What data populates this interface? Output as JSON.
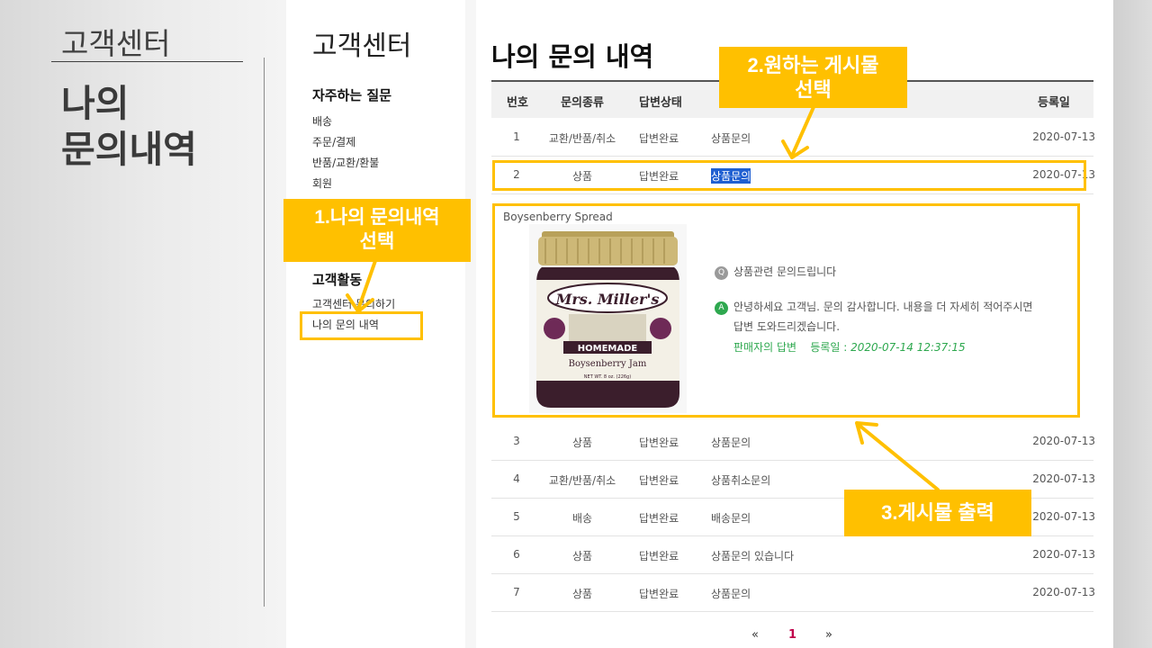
{
  "slide": {
    "subtitle": "고객센터",
    "title_line1": "나의",
    "title_line2": "문의내역"
  },
  "sidebar": {
    "title": "고객센터",
    "faq_heading": "자주하는 질문",
    "faq_items": [
      "배송",
      "주문/결제",
      "반품/교환/환불",
      "회원"
    ],
    "activity_heading": "고객활동",
    "activity_items": [
      "고객센터 문의하기",
      "나의 문의 내역"
    ]
  },
  "main": {
    "title": "나의 문의 내역",
    "columns": [
      "번호",
      "문의종류",
      "답변상태",
      "등록일"
    ],
    "rows": [
      {
        "num": "1",
        "type": "교환/반품/취소",
        "status": "답변완료",
        "title": "상품문의",
        "date": "2020-07-13"
      },
      {
        "num": "2",
        "type": "상품",
        "status": "답변완료",
        "title": "상품문의",
        "date": "2020-07-13"
      },
      {
        "num": "3",
        "type": "상품",
        "status": "답변완료",
        "title": "상품문의",
        "date": "2020-07-13"
      },
      {
        "num": "4",
        "type": "교환/반품/취소",
        "status": "답변완료",
        "title": "상품취소문의",
        "date": "2020-07-13"
      },
      {
        "num": "5",
        "type": "배송",
        "status": "답변완료",
        "title": "배송문의",
        "date": "2020-07-13"
      },
      {
        "num": "6",
        "type": "상품",
        "status": "답변완료",
        "title": "상품문의 있습니다",
        "date": "2020-07-13"
      },
      {
        "num": "7",
        "type": "상품",
        "status": "답변완료",
        "title": "상품문의",
        "date": "2020-07-13"
      }
    ],
    "detail": {
      "product_name": "Boysenberry Spread",
      "q_badge": "Q",
      "question": "상품관련 문의드립니다",
      "a_badge": "A",
      "answer_line1": "안녕하세요 고객님. 문의 감사합니다. 내용을 더 자세히 적어주시면",
      "answer_line2": "답변 도와드리겠습니다.",
      "seller_label": "판매자의 답변",
      "reg_label": "등록일 :",
      "reg_date": "2020-07-14 12:37:15",
      "jar_label_brand": "Mrs. Miller's",
      "jar_label_homemade": "HOMEMADE",
      "jar_label_product": "Boysenberry Jam",
      "jar_label_weight": "NET WT. 8 oz. (226g)"
    },
    "pagination": {
      "prev": "«",
      "current": "1",
      "next": "»"
    }
  },
  "annotations": {
    "step1_line1": "1.나의 문의내역",
    "step1_line2": "선택",
    "step2_line1": "2.원하는 게시물",
    "step2_line2": "선택",
    "step3": "3.게시물 출력"
  },
  "colors": {
    "annotation": "#ffc000",
    "answer_green": "#2ea84f",
    "pager_active": "#c0004a",
    "selection_blue": "#1f5fd1"
  }
}
